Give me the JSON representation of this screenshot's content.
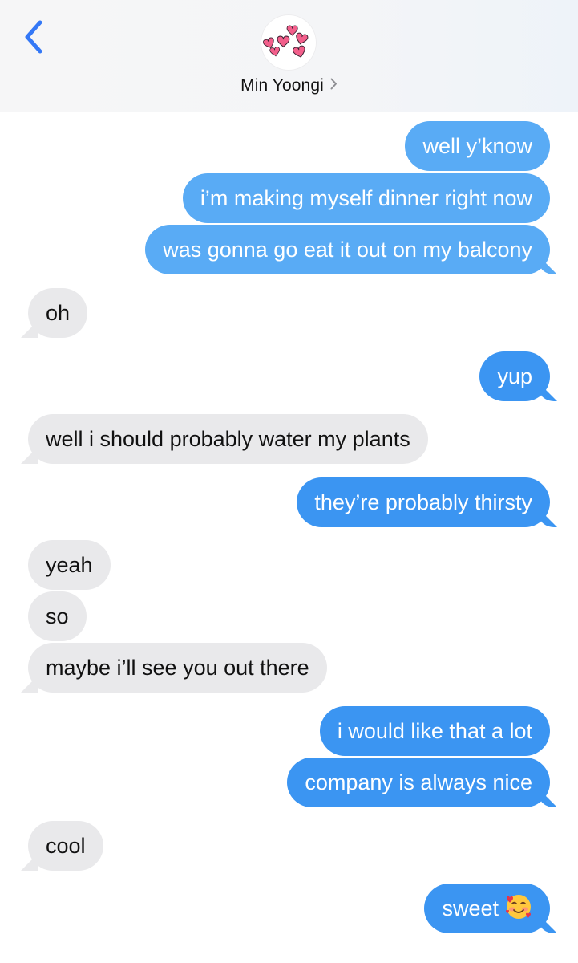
{
  "header": {
    "contact_name": "Min Yoongi",
    "back_icon": "chevron-left-icon",
    "avatar_icon": "hearts-icon",
    "disclosure_icon": "chevron-right-icon",
    "accent_color": "#3478f6"
  },
  "messages": [
    {
      "side": "sent",
      "text": "well y’know"
    },
    {
      "side": "sent",
      "text": "i’m making myself dinner right now"
    },
    {
      "side": "sent",
      "text": "was gonna go eat it out on my balcony"
    },
    {
      "side": "received",
      "text": "oh"
    },
    {
      "side": "sent",
      "text": "yup"
    },
    {
      "side": "received",
      "text": "well i should probably water my plants"
    },
    {
      "side": "sent",
      "text": "they’re probably thirsty"
    },
    {
      "side": "received",
      "text": "yeah"
    },
    {
      "side": "received",
      "text": "so"
    },
    {
      "side": "received",
      "text": "maybe i’ll see you out there"
    },
    {
      "side": "sent",
      "text": "i would like that a lot"
    },
    {
      "side": "sent",
      "text": "company is always nice"
    },
    {
      "side": "received",
      "text": "cool"
    },
    {
      "side": "sent",
      "text": "sweet",
      "emoji": "smiling-face-with-hearts-icon"
    }
  ],
  "colors": {
    "sent_bubble": "#3b95f2",
    "received_bubble": "#e9e9eb",
    "sent_text": "#ffffff",
    "received_text": "#111111"
  }
}
